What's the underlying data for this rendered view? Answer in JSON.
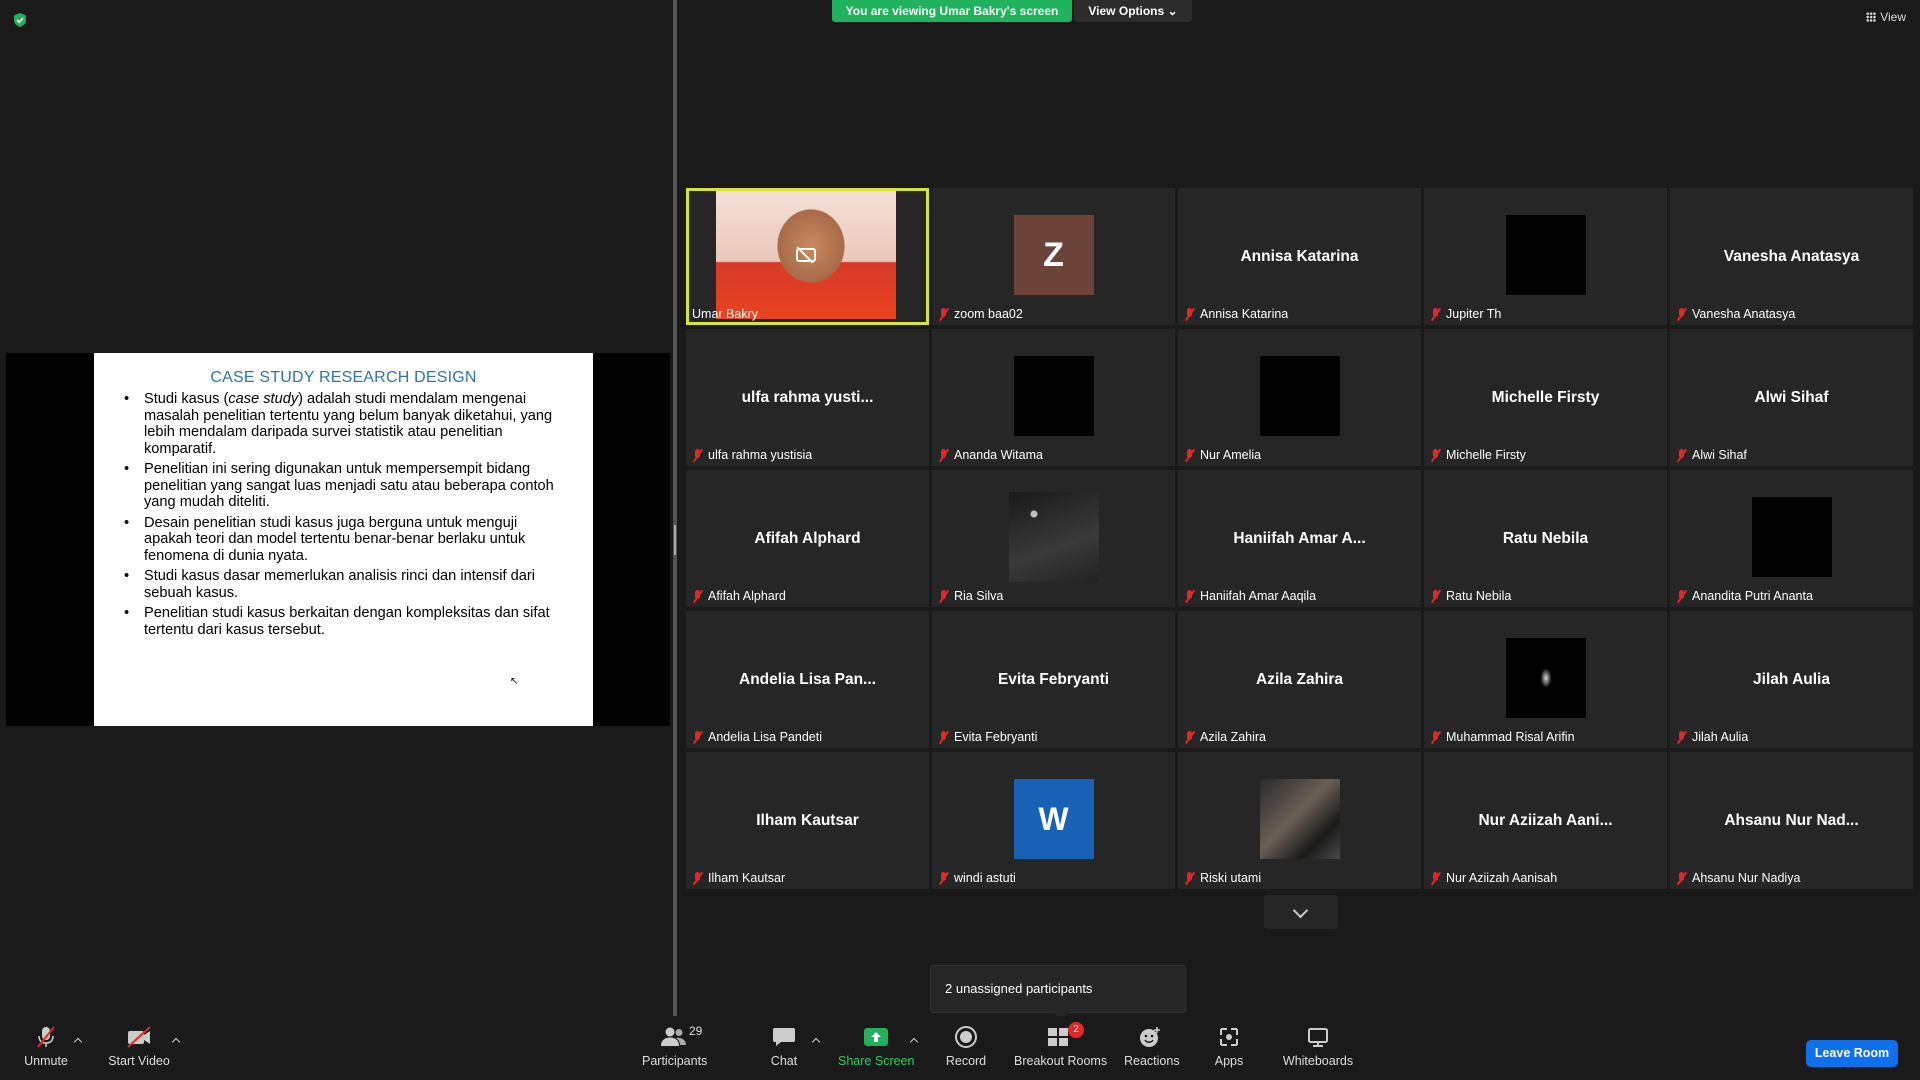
{
  "banner": {
    "text": "You are viewing Umar Bakry's screen",
    "view_options": "View Options"
  },
  "view_button": "View",
  "slide": {
    "title": "CASE STUDY RESEARCH DESIGN",
    "bullets": [
      {
        "pre": "Studi kasus (",
        "em": "case study",
        "post": ") adalah studi mendalam mengenai masalah penelitian tertentu yang belum banyak diketahui, yang lebih mendalam daripada survei statistik atau penelitian komparatif."
      },
      {
        "pre": "Penelitian ini sering digunakan untuk mempersempit bidang penelitian yang sangat luas menjadi satu atau beberapa contoh yang mudah diteliti.",
        "em": "",
        "post": ""
      },
      {
        "pre": "Desain penelitian studi kasus juga berguna untuk menguji apakah teori dan model tertentu benar-benar berlaku untuk fenomena di dunia nyata.",
        "em": "",
        "post": ""
      },
      {
        "pre": "Studi kasus dasar memerlukan analisis rinci dan intensif dari sebuah kasus.",
        "em": "",
        "post": ""
      },
      {
        "pre": "Penelitian studi kasus berkaitan dengan kompleksitas dan sifat tertentu dari kasus tersebut.",
        "em": "",
        "post": ""
      }
    ]
  },
  "participants": [
    {
      "label": "Umar Bakry",
      "big": "",
      "kind": "photo-red",
      "active": true,
      "muted": false
    },
    {
      "label": "zoom baa02",
      "big": "",
      "kind": "avatar-z",
      "letter": "Z",
      "muted": true
    },
    {
      "label": "Annisa Katarina",
      "big": "Annisa Katarina",
      "kind": "name",
      "muted": true
    },
    {
      "label": "Jupiter Th",
      "big": "",
      "kind": "black",
      "muted": true
    },
    {
      "label": "Vanesha Anatasya",
      "big": "Vanesha Anatasya",
      "kind": "name",
      "muted": true
    },
    {
      "label": "ulfa rahma yustisia",
      "big": "ulfa rahma yusti...",
      "kind": "name",
      "muted": true
    },
    {
      "label": "Ananda Witama",
      "big": "",
      "kind": "black",
      "muted": true
    },
    {
      "label": "Nur Amelia",
      "big": "",
      "kind": "black",
      "muted": true
    },
    {
      "label": "Michelle Firsty",
      "big": "Michelle Firsty",
      "kind": "name",
      "muted": true
    },
    {
      "label": "Alwi Sihaf",
      "big": "Alwi Sihaf",
      "kind": "name",
      "muted": true
    },
    {
      "label": "Afifah Alphard",
      "big": "Afifah Alphard",
      "kind": "name",
      "muted": true
    },
    {
      "label": "Ria Silva",
      "big": "",
      "kind": "photo-night",
      "muted": true
    },
    {
      "label": "Haniifah Amar Aaqila",
      "big": "Haniifah Amar A...",
      "kind": "name",
      "muted": true
    },
    {
      "label": "Ratu Nebila",
      "big": "Ratu Nebila",
      "kind": "name",
      "muted": true
    },
    {
      "label": "Anandita Putri Ananta",
      "big": "",
      "kind": "black",
      "muted": true
    },
    {
      "label": "Andelia Lisa Pandeti",
      "big": "Andelia Lisa Pan...",
      "kind": "name",
      "muted": true
    },
    {
      "label": "Evita Febryanti",
      "big": "Evita Febryanti",
      "kind": "name",
      "muted": true
    },
    {
      "label": "Azila Zahira",
      "big": "Azila Zahira",
      "kind": "name",
      "muted": true
    },
    {
      "label": "Muhammad Risal Arifin",
      "big": "",
      "kind": "photo-hand",
      "muted": true
    },
    {
      "label": "Jilah Aulia",
      "big": "Jilah Aulia",
      "kind": "name",
      "muted": true
    },
    {
      "label": "Ilham Kautsar",
      "big": "Ilham Kautsar",
      "kind": "name",
      "muted": true
    },
    {
      "label": "windi astuti",
      "big": "",
      "kind": "avatar-w",
      "letter": "W",
      "muted": true
    },
    {
      "label": "Riski utami",
      "big": "",
      "kind": "photo-riski",
      "muted": true
    },
    {
      "label": "Nur Aziizah Aanisah",
      "big": "Nur Aziizah Aani...",
      "kind": "name",
      "muted": true
    },
    {
      "label": "Ahsanu Nur Nadiya",
      "big": "Ahsanu Nur Nad...",
      "kind": "name",
      "muted": true
    }
  ],
  "tooltip": "2 unassigned participants",
  "toolbar": {
    "unmute": "Unmute",
    "start_video": "Start Video",
    "participants": "Participants",
    "participants_count": "29",
    "chat": "Chat",
    "share_screen": "Share Screen",
    "record": "Record",
    "breakout_rooms": "Breakout Rooms",
    "breakout_badge": "2",
    "reactions": "Reactions",
    "apps": "Apps",
    "whiteboards": "Whiteboards",
    "leave": "Leave Room"
  },
  "colors": {
    "share_green": "#21b25d",
    "leave_blue": "#0e71eb",
    "muted_red": "#e02828",
    "active_border": "#d8e338"
  }
}
